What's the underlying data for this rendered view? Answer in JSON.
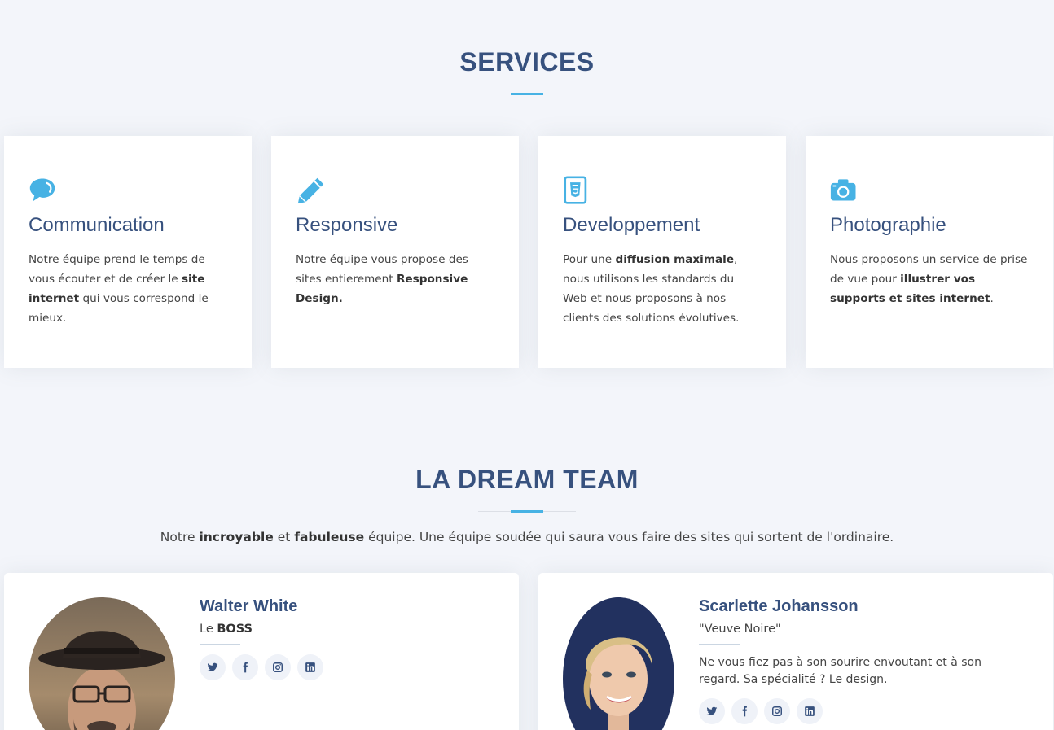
{
  "services": {
    "title": "SERVICES",
    "cards": [
      {
        "icon": "chat-bubble-icon",
        "title": "Communication",
        "text": [
          {
            "t": "Notre équipe prend le temps de vous écouter et de créer le ",
            "b": false
          },
          {
            "t": "site internet",
            "b": true
          },
          {
            "t": " qui vous correspond le mieux.",
            "b": false
          }
        ]
      },
      {
        "icon": "pencil-icon",
        "title": "Responsive",
        "text": [
          {
            "t": "Notre équipe vous propose des sites entierement ",
            "b": false
          },
          {
            "t": "Responsive Design.",
            "b": true
          }
        ]
      },
      {
        "icon": "html5-file-icon",
        "title": "Developpement",
        "text": [
          {
            "t": "Pour une ",
            "b": false
          },
          {
            "t": "diffusion maximale",
            "b": true
          },
          {
            "t": ", nous utilisons les standards du Web et nous proposons à nos clients des solutions évolutives.",
            "b": false
          }
        ]
      },
      {
        "icon": "camera-icon",
        "title": "Photographie",
        "text": [
          {
            "t": "Nous proposons un service de prise de vue pour ",
            "b": false
          },
          {
            "t": "illustrer vos supports et sites internet",
            "b": true
          },
          {
            "t": ".",
            "b": false
          }
        ]
      }
    ]
  },
  "team": {
    "title": "LA DREAM TEAM",
    "intro": [
      {
        "t": "Notre ",
        "b": false
      },
      {
        "t": "incroyable",
        "b": true
      },
      {
        "t": " et ",
        "b": false
      },
      {
        "t": "fabuleuse",
        "b": true
      },
      {
        "t": " équipe. Une équipe soudée qui saura vous faire des sites qui sortent de l'ordinaire.",
        "b": false
      }
    ],
    "members": [
      {
        "name": "Walter White",
        "role": [
          {
            "t": "Le ",
            "b": false
          },
          {
            "t": "BOSS",
            "b": true
          }
        ],
        "bio": ""
      },
      {
        "name": "Scarlette Johansson",
        "role": [
          {
            "t": "\"Veuve Noire\"",
            "b": false
          }
        ],
        "bio": "Ne vous fiez pas à son sourire envoutant et à son regard. Sa spécialité ? Le design."
      }
    ],
    "social_icons": [
      "twitter-icon",
      "facebook-icon",
      "instagram-icon",
      "linkedin-icon"
    ]
  },
  "colors": {
    "accent": "#47b2e4",
    "heading": "#37517e",
    "background": "#f3f5fa"
  }
}
